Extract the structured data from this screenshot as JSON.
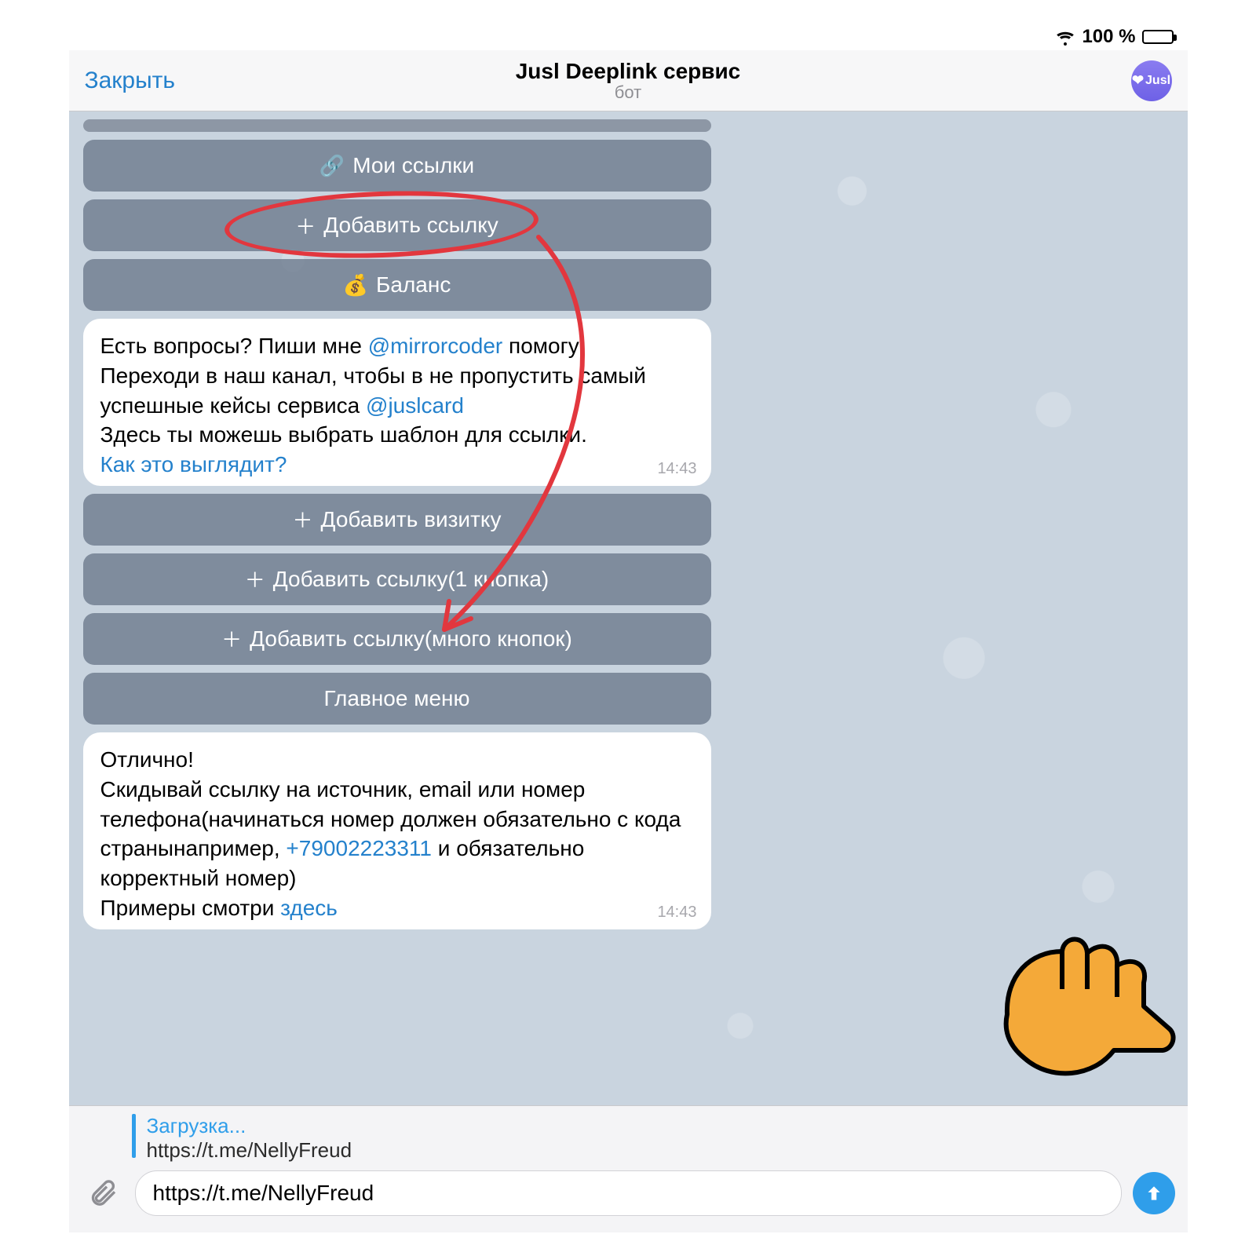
{
  "status": {
    "battery_text": "100 %"
  },
  "header": {
    "close_label": "Закрыть",
    "title": "Jusl Deeplink сервис",
    "subtitle": "бот",
    "avatar_label": "Jusl"
  },
  "menu1": {
    "items": [
      {
        "icon": "🔗",
        "label": "Мои ссылки"
      },
      {
        "icon": "＋",
        "label": "Добавить ссылку"
      },
      {
        "icon": "💰",
        "label": "Баланс"
      }
    ]
  },
  "msg1": {
    "t1a": "Есть вопросы? Пиши мне ",
    "t1_link": "@mirrorcoder",
    "t1b": " помогу",
    "t2": "Переходи в наш канал, чтобы в не пропустить самый успешные кейсы сервиса ",
    "t2_link": "@juslcard",
    "t3": "Здесь ты можешь выбрать шаблон для ссылки.",
    "t4_link": "Как это выглядит?",
    "time": "14:43"
  },
  "menu2": {
    "items": [
      {
        "icon": "＋",
        "label": "Добавить визитку"
      },
      {
        "icon": "＋",
        "label": "Добавить ссылку(1 кнопка)"
      },
      {
        "icon": "＋",
        "label": "Добавить ссылку(много кнопок)"
      },
      {
        "icon": "",
        "label": "Главное меню"
      }
    ]
  },
  "msg2": {
    "t1": "Отлично!",
    "t2a": "Скидывай ссылку на источник, email или номер телефона(начинаться номер должен обязательно с кода странынапример, ",
    "t2_link": "+79002223311",
    "t2b": " и обязательно корректный номер)",
    "t3a": "Примеры смотри ",
    "t3_link": "здесь",
    "time": "14:43"
  },
  "reply": {
    "title": "Загрузка...",
    "subtitle": "https://t.me/NellyFreud"
  },
  "input": {
    "value": "https://t.me/NellyFreud"
  },
  "colors": {
    "accent": "#2f9eea",
    "annotation": "#e2373e"
  }
}
